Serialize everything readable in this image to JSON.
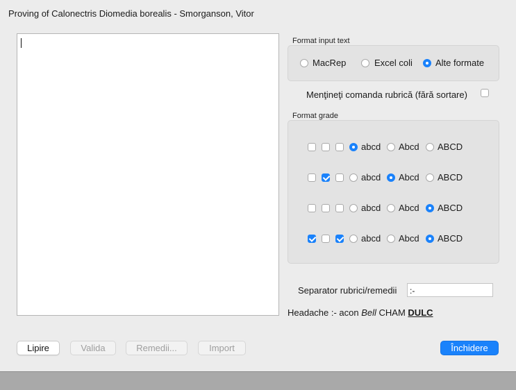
{
  "window": {
    "title": "Proving of Calonectris Diomedia borealis - Smorganson, Vitor"
  },
  "editor": {
    "text": ""
  },
  "format_input": {
    "label": "Format input text",
    "options": [
      "MacRep",
      "Excel coli",
      "Alte formate"
    ],
    "selected": "Alte formate"
  },
  "keep_order": {
    "label": "Menţineţi comanda rubrică (fără sortare)",
    "checked": false
  },
  "format_grade": {
    "label": "Format grade",
    "rows": [
      {
        "checks": [
          false,
          false,
          false
        ],
        "options": [
          "abcd",
          "Abcd",
          "ABCD"
        ],
        "selected": "abcd"
      },
      {
        "checks": [
          false,
          true,
          false
        ],
        "options": [
          "abcd",
          "Abcd",
          "ABCD"
        ],
        "selected": "Abcd"
      },
      {
        "checks": [
          false,
          false,
          false
        ],
        "options": [
          "abcd",
          "Abcd",
          "ABCD"
        ],
        "selected": "ABCD"
      },
      {
        "checks": [
          true,
          false,
          true
        ],
        "options": [
          "abcd",
          "Abcd",
          "ABCD"
        ],
        "selected": "ABCD"
      }
    ]
  },
  "separator": {
    "label": "Separator rubrici/remedii",
    "value": ":-"
  },
  "preview": {
    "prefix": "Headache :- acon ",
    "italic": "Bell",
    "plain": " CHAM ",
    "bold_underline": "DULC"
  },
  "buttons": {
    "paste": "Lipire",
    "validate": "Valida",
    "remedies": "Remedii...",
    "import": "Import",
    "close": "Închidere"
  }
}
